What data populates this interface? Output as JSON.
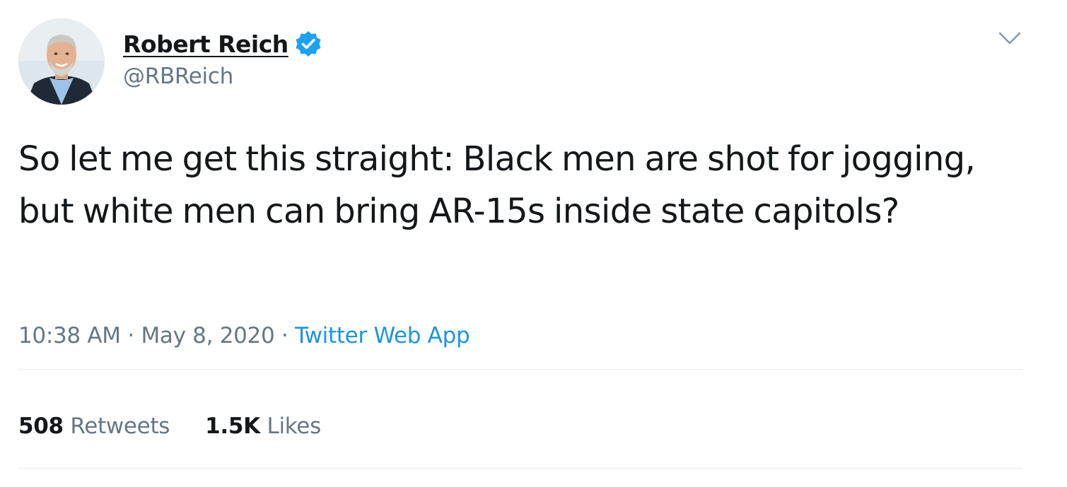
{
  "author": {
    "display_name": "Robert Reich",
    "handle": "@RBReich",
    "verified": true,
    "avatar_icon": "profile-photo"
  },
  "tweet": {
    "text": "So let me get this straight: Black men are shot for jogging, but white men can bring AR-15s inside state capitols?",
    "time": "10:38 AM",
    "separator": "·",
    "date": "May 8, 2020",
    "source": "Twitter Web App"
  },
  "stats": {
    "retweets_count": "508",
    "retweets_label": "Retweets",
    "likes_count": "1.5K",
    "likes_label": "Likes"
  },
  "icons": {
    "verified": "verified-badge-icon",
    "menu": "chevron-down-icon"
  },
  "colors": {
    "text_primary": "#14171a",
    "text_secondary": "#657786",
    "link": "#1b95e0",
    "verified_badge": "#1da1f2",
    "divider": "#e6ecf0"
  }
}
